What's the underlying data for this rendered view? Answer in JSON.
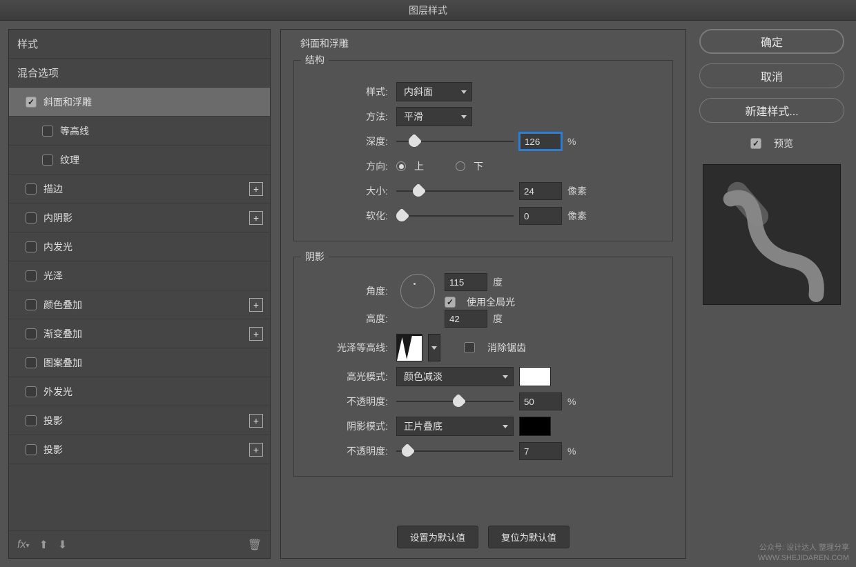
{
  "title": "图层样式",
  "sidebar": {
    "styles_header": "样式",
    "blend_options": "混合选项",
    "items": [
      {
        "label": "斜面和浮雕",
        "checked": true
      },
      {
        "label": "等高线",
        "checked": false
      },
      {
        "label": "纹理",
        "checked": false
      },
      {
        "label": "描边",
        "checked": false
      },
      {
        "label": "内阴影",
        "checked": false
      },
      {
        "label": "内发光",
        "checked": false
      },
      {
        "label": "光泽",
        "checked": false
      },
      {
        "label": "颜色叠加",
        "checked": false
      },
      {
        "label": "渐变叠加",
        "checked": false
      },
      {
        "label": "图案叠加",
        "checked": false
      },
      {
        "label": "外发光",
        "checked": false
      },
      {
        "label": "投影",
        "checked": false
      },
      {
        "label": "投影",
        "checked": false
      }
    ],
    "fx_label": "fx"
  },
  "bevel": {
    "panel_title": "斜面和浮雕",
    "structure_title": "结构",
    "style_label": "样式:",
    "style_value": "内斜面",
    "technique_label": "方法:",
    "technique_value": "平滑",
    "depth_label": "深度:",
    "depth_value": "126",
    "percent": "%",
    "direction_label": "方向:",
    "dir_up": "上",
    "dir_down": "下",
    "size_label": "大小:",
    "size_value": "24",
    "px": "像素",
    "soften_label": "软化:",
    "soften_value": "0",
    "shading_title": "阴影",
    "angle_label": "角度:",
    "angle_value": "115",
    "deg": "度",
    "use_global": "使用全局光",
    "altitude_label": "高度:",
    "altitude_value": "42",
    "gloss_label": "光泽等高线:",
    "antialias": "消除锯齿",
    "hl_mode_label": "高光模式:",
    "hl_mode_value": "颜色减淡",
    "opacity_label": "不透明度:",
    "hl_opacity_value": "50",
    "sh_mode_label": "阴影模式:",
    "sh_mode_value": "正片叠底",
    "sh_opacity_value": "7",
    "make_default": "设置为默认值",
    "reset_default": "复位为默认值"
  },
  "right": {
    "ok": "确定",
    "cancel": "取消",
    "new_style": "新建样式...",
    "preview": "预览"
  },
  "watermark": {
    "line1": "公众号: 设计达人 整理分享",
    "line2": "WWW.SHEJIDAREN.COM"
  }
}
